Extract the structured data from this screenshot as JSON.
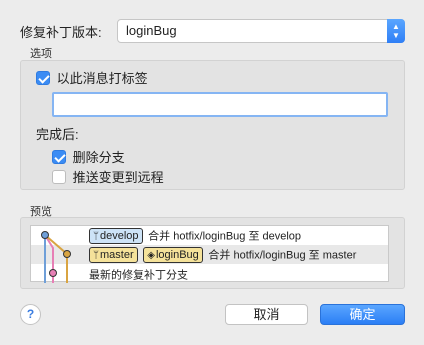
{
  "version": {
    "label": "修复补丁版本:",
    "selected": "loginBug"
  },
  "options": {
    "title": "选项",
    "tag_checkbox_label": "以此消息打标签",
    "tag_input_value": "",
    "after_label": "完成后:",
    "delete_branch_label": "删除分支",
    "push_remote_label": "推送变更到远程"
  },
  "preview": {
    "title": "预览",
    "rows": [
      {
        "refs": [
          "develop"
        ],
        "text": "合并 hotfix/loginBug 至 develop"
      },
      {
        "refs": [
          "master",
          "loginBug"
        ],
        "text": "合并 hotfix/loginBug 至 master"
      },
      {
        "refs": [],
        "text": "最新的修复补丁分支"
      }
    ],
    "colors": {
      "develop": "#cde3f7",
      "master": "#f5e29a",
      "line_blue": "#6f9fd8",
      "line_pink": "#e77fb5",
      "line_orange": "#d9a441"
    }
  },
  "buttons": {
    "help": "?",
    "cancel": "取消",
    "ok": "确定"
  }
}
